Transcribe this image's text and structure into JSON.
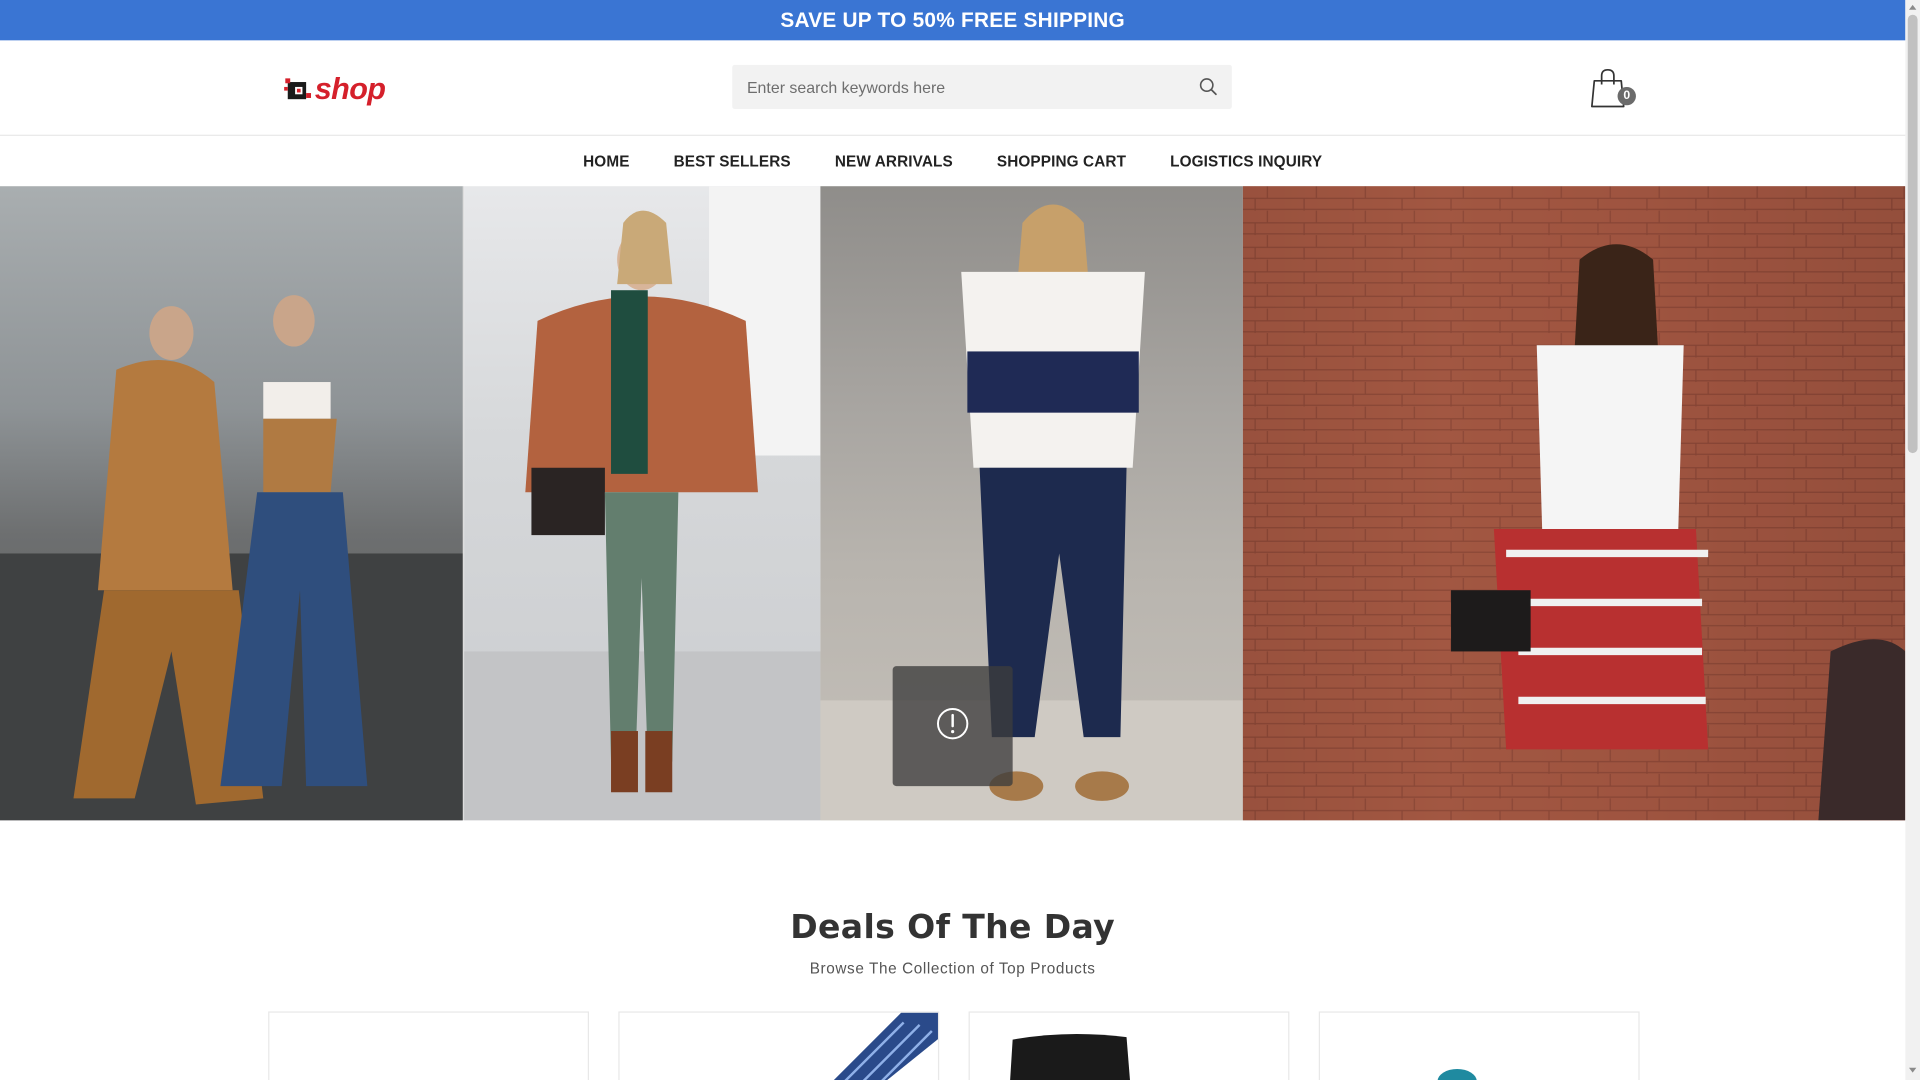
{
  "announcement": {
    "text": "SAVE UP TO 50% FREE SHIPPING"
  },
  "header": {
    "logo_text": "shop",
    "search": {
      "placeholder": "Enter search keywords here",
      "value": ""
    },
    "cart": {
      "count": "0"
    }
  },
  "nav": {
    "items": [
      {
        "label": "HOME"
      },
      {
        "label": "BEST SELLERS"
      },
      {
        "label": "NEW ARRIVALS"
      },
      {
        "label": "SHOPPING CART"
      },
      {
        "label": "LOGISTICS INQUIRY"
      }
    ]
  },
  "hero": {
    "panels": [
      {
        "icon": "street-fashion-photo-1"
      },
      {
        "icon": "street-fashion-photo-2"
      },
      {
        "icon": "street-fashion-photo-3"
      },
      {
        "icon": "street-fashion-photo-4"
      }
    ],
    "overlay_icon": "alert-circle-icon"
  },
  "deals": {
    "title": "Deals Of The Day",
    "subtitle": "Browse The Collection of Top Products"
  },
  "colors": {
    "announce_bg": "#3a75d3",
    "logo_red": "#d5202b",
    "text": "#222222"
  }
}
